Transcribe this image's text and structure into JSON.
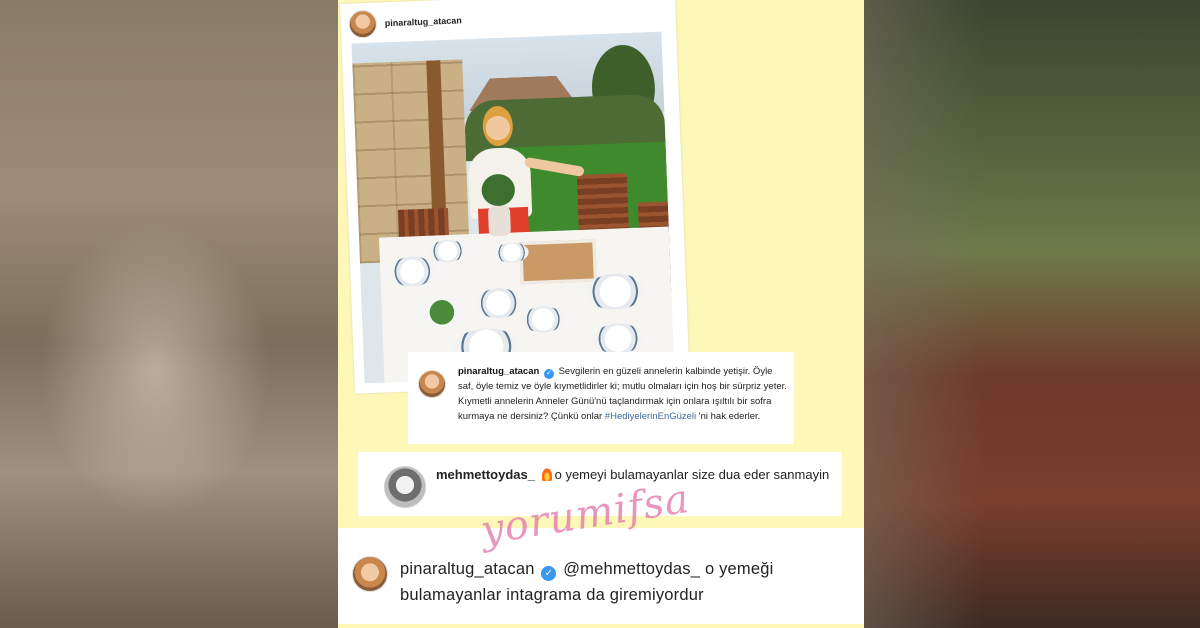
{
  "post": {
    "username": "pinaraltug_atacan"
  },
  "caption": {
    "username": "pinaraltug_atacan",
    "text_part1": "Sevgilerin en güzeli annelerin kalbinde yetişir. Öyle saf, öyle temiz ve öyle kıymetlidirler ki; mutlu olmaları için hoş bir sürpriz yeter. Kıymetli annelerin Anneler Günü'nü taçlandırmak için onlara ışıltılı bir sofra kurmaya ne dersiniz? Çünkü onlar",
    "hashtag": "#HediyelerinEnGüzeli",
    "text_part2": "'ni hak ederler."
  },
  "comment": {
    "username": "mehmettoydas_",
    "icon": "fire-icon",
    "text": "o yemeyi bulamayanlar  size  dua eder  sanmayin"
  },
  "reply": {
    "username": "pinaraltug_atacan",
    "mention": "@mehmettoydas_",
    "text": "o yemeği bulamayanlar intagrama da giremiyordur"
  },
  "watermark": "yorumifsa",
  "colors": {
    "panel_bg": "#fdf7b8",
    "verified": "#3897f0",
    "hashtag": "#3f6a9c",
    "watermark": "#e278aa"
  }
}
